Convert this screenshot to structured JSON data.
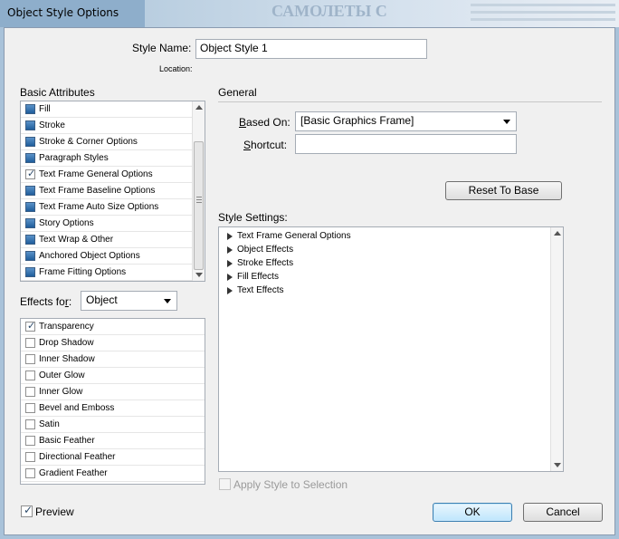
{
  "window": {
    "title": "Object Style Options",
    "background_ghost_text": "САМОЛЕТЫ С"
  },
  "style_name": {
    "label": "Style Name:",
    "value": "Object Style 1",
    "location_label": "Location:"
  },
  "basic_attributes": {
    "heading": "Basic Attributes",
    "items": [
      {
        "label": "Fill",
        "checked": false
      },
      {
        "label": "Stroke",
        "checked": false
      },
      {
        "label": "Stroke & Corner Options",
        "checked": false
      },
      {
        "label": "Paragraph Styles",
        "checked": false
      },
      {
        "label": "Text Frame General Options",
        "checked": true
      },
      {
        "label": "Text Frame Baseline Options",
        "checked": false
      },
      {
        "label": "Text Frame Auto Size Options",
        "checked": false
      },
      {
        "label": "Story Options",
        "checked": false
      },
      {
        "label": "Text Wrap & Other",
        "checked": false
      },
      {
        "label": "Anchored Object Options",
        "checked": false
      },
      {
        "label": "Frame Fitting Options",
        "checked": false
      }
    ]
  },
  "effects_for": {
    "label_prefix": "Effects fo",
    "label_underlined": "r",
    "label_suffix": ":",
    "selected": "Object"
  },
  "effects": [
    {
      "label": "Transparency",
      "checked": true
    },
    {
      "label": "Drop Shadow",
      "checked": false
    },
    {
      "label": "Inner Shadow",
      "checked": false
    },
    {
      "label": "Outer Glow",
      "checked": false
    },
    {
      "label": "Inner Glow",
      "checked": false
    },
    {
      "label": "Bevel and Emboss",
      "checked": false
    },
    {
      "label": "Satin",
      "checked": false
    },
    {
      "label": "Basic Feather",
      "checked": false
    },
    {
      "label": "Directional Feather",
      "checked": false
    },
    {
      "label": "Gradient Feather",
      "checked": false
    }
  ],
  "general": {
    "heading": "General",
    "based_on_label_u": "B",
    "based_on_label_rest": "ased On:",
    "based_on_value": "[Basic Graphics Frame]",
    "shortcut_label_u": "S",
    "shortcut_label_rest": "hortcut:",
    "shortcut_value": "",
    "reset_button": "Reset To Base"
  },
  "style_settings": {
    "heading": "Style Settings:",
    "items": [
      "Text Frame General Options",
      "Object Effects",
      "Stroke Effects",
      "Fill Effects",
      "Text Effects"
    ]
  },
  "apply_style": {
    "label": "Apply Style to Selection",
    "checked": false,
    "enabled": false
  },
  "preview": {
    "label": "Preview",
    "checked": true
  },
  "buttons": {
    "ok": "OK",
    "cancel": "Cancel"
  }
}
